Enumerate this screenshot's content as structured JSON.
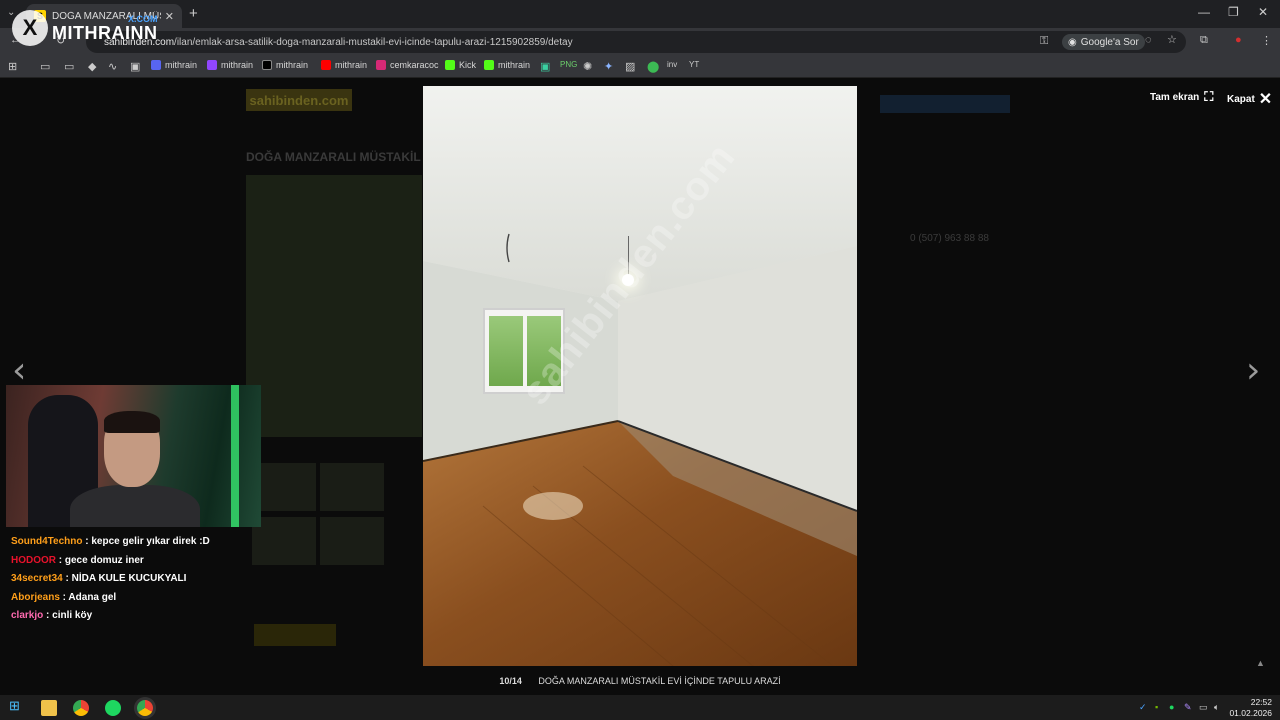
{
  "browser": {
    "tab_title": "DOĞA MANZARALI MÜSTAKİL",
    "tab_favicon": "S",
    "url_domain": "sahibinden.com",
    "url_path": "/ilan/emlak-arsa-satilik-doga-manzarali-mustakil-evi-icinde-tapulu-arazi-1215902859/detay",
    "google_sor": "Google'a Sor",
    "new_tab": "+",
    "tab_close": "✕",
    "bookmarks": [
      {
        "label": "mithrain",
        "color": "#5865f2"
      },
      {
        "label": "mithrain",
        "color": "#9146ff"
      },
      {
        "label": "mithrain",
        "color": "#000000"
      },
      {
        "label": "mithrain",
        "color": "#ff0000"
      },
      {
        "label": "cemkaracoc",
        "color": "#d62976"
      },
      {
        "label": "Kick",
        "color": "#53fc18"
      },
      {
        "label": "mithrain",
        "color": "#53fc18"
      }
    ]
  },
  "overlay_logo": {
    "letter": "X",
    "site": "X.COM",
    "name": "MITHRAINN"
  },
  "lightbox": {
    "fullscreen_label": "Tam ekran",
    "close_label": "Kapat",
    "prev_arrow": "‹",
    "next_arrow": "›",
    "counter": "10/14",
    "caption": "DOĞA MANZARALI MÜSTAKİL EVİ İÇİNDE TAPULU ARAZİ",
    "watermark": "sahibinden.com"
  },
  "chat": [
    {
      "user": "Sound4Techno",
      "color": "#ff9f1a",
      "message": " : kepce gelir yıkar direk :D"
    },
    {
      "user": "HODOOR",
      "color": "#e8122b",
      "message": " : gece domuz iner"
    },
    {
      "user": "34secret34",
      "color": "#ff9f1a",
      "message": " : NİDA KULE KUCUKYALI"
    },
    {
      "user": "Aborjeans",
      "color": "#ff9f1a",
      "message": " : Adana gel"
    },
    {
      "user": "clarkjo",
      "color": "#ff6ab0",
      "message": " : cinli köy"
    }
  ],
  "background_page": {
    "brand": "sahibinden.com",
    "title": "DOĞA MANZARALI MÜSTAKİL",
    "phone": "0 (507) 963 88 88"
  },
  "taskbar": {
    "time": "22:52",
    "date": "01.02.2026"
  }
}
